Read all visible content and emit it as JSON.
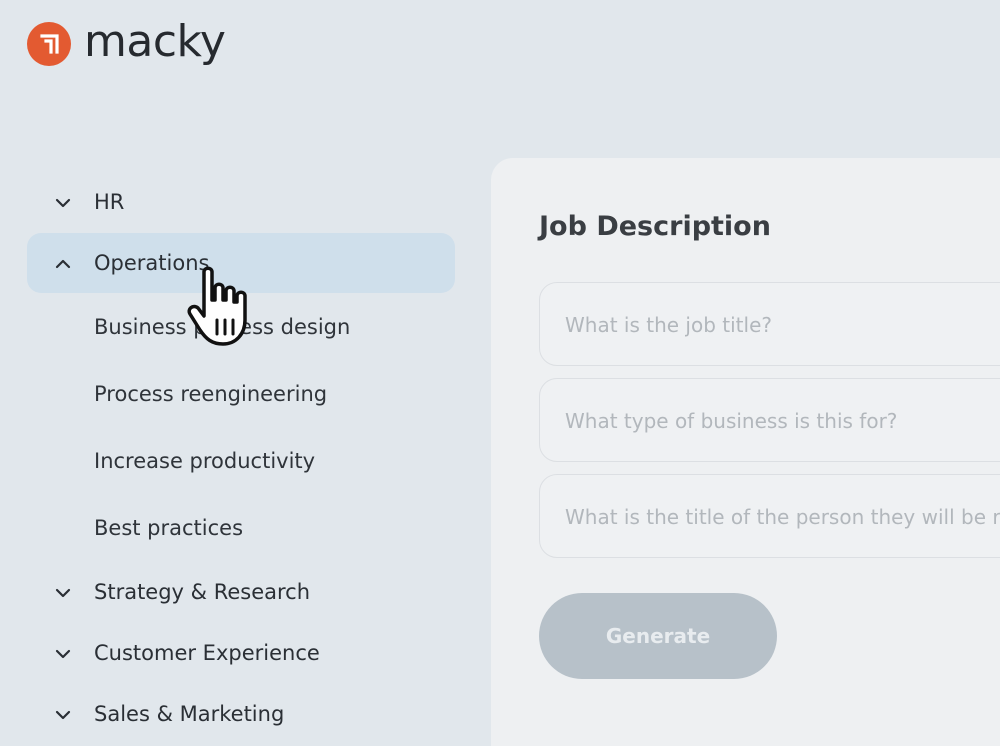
{
  "brand": {
    "name": "macky",
    "color": "#e35a31"
  },
  "sidebar": {
    "categories": [
      {
        "label": "HR",
        "icon": "chevron-down-icon"
      },
      {
        "label": "Operations",
        "icon": "chevron-up-icon",
        "expanded": true,
        "items": [
          {
            "label": "Business process design"
          },
          {
            "label": "Process reengineering"
          },
          {
            "label": "Increase productivity"
          },
          {
            "label": "Best practices"
          }
        ]
      },
      {
        "label": "Strategy & Research",
        "icon": "chevron-down-icon"
      },
      {
        "label": "Customer Experience",
        "icon": "chevron-down-icon"
      },
      {
        "label": "Sales & Marketing",
        "icon": "chevron-down-icon"
      }
    ]
  },
  "panel": {
    "title": "Job Description",
    "fields": [
      {
        "placeholder": "What is the job title?"
      },
      {
        "placeholder": "What type of business is this for?"
      },
      {
        "placeholder": "What is the title of the person they will be reporting to?"
      }
    ],
    "generate_label": "Generate"
  }
}
